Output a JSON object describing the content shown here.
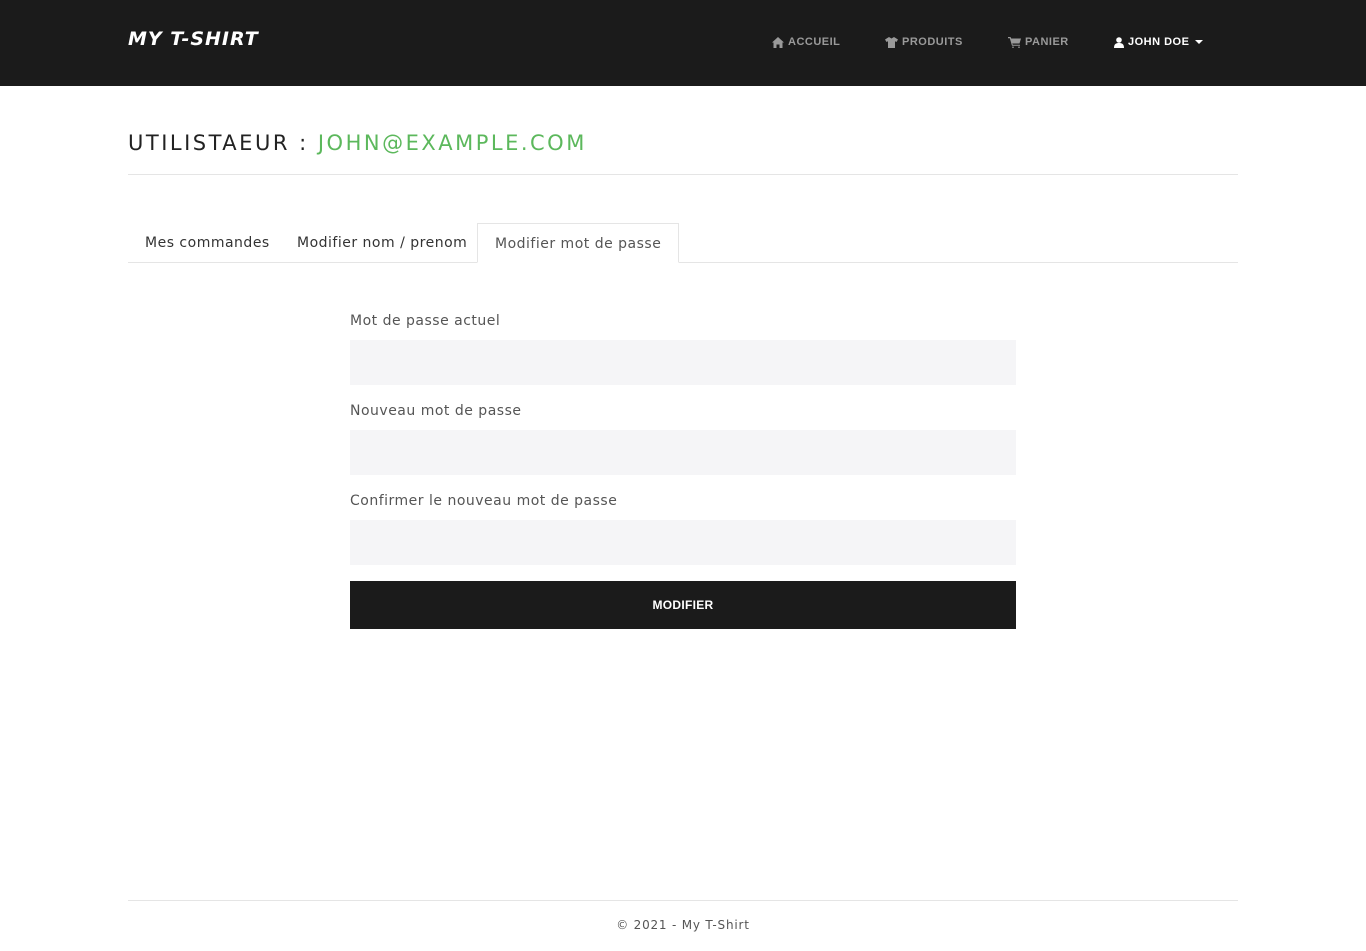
{
  "brand": "MY T-SHIRT",
  "nav": {
    "home": "ACCUEIL",
    "products": "PRODUITS",
    "cart": "PANIER",
    "user": "JOHN DOE"
  },
  "header": {
    "prefix": "UTILISTAEUR : ",
    "email": "JOHN@EXAMPLE.COM"
  },
  "tabs": [
    {
      "label": "Mes commandes"
    },
    {
      "label": "Modifier nom / prenom"
    },
    {
      "label": "Modifier mot de passe"
    }
  ],
  "form": {
    "current_label": "Mot de passe actuel",
    "new_label": "Nouveau mot de passe",
    "confirm_label": "Confirmer le nouveau mot de passe",
    "submit_label": "MODIFIER"
  },
  "footer": "© 2021 - My T-Shirt"
}
